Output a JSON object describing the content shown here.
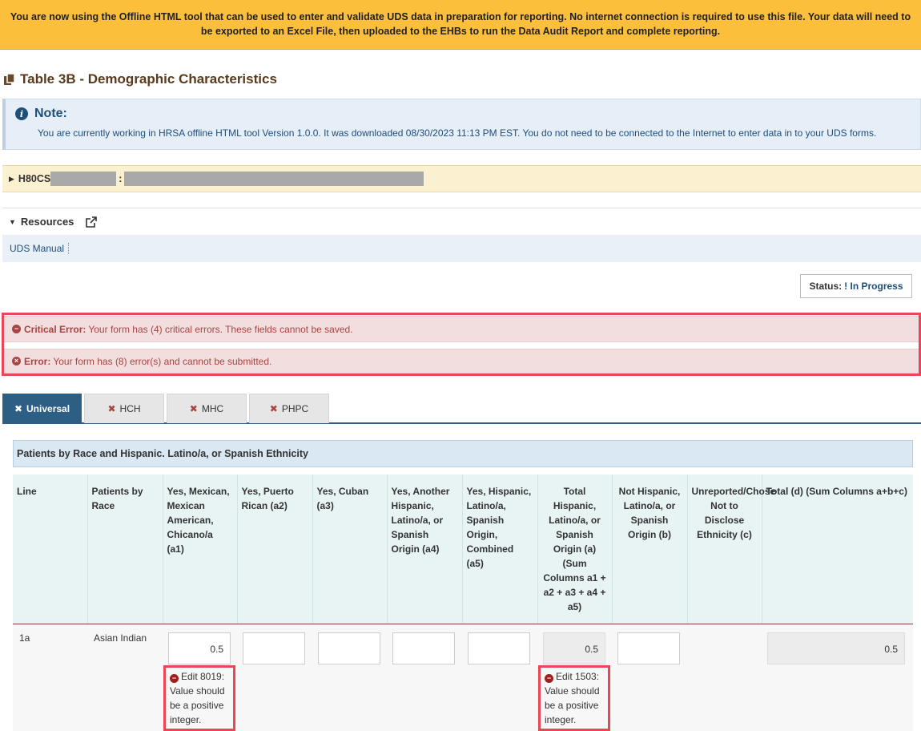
{
  "banner": {
    "text": "You are now using the Offline HTML tool that can be used to enter and validate UDS data in preparation for reporting. No internet connection is required to use this file. Your data will need to be exported to an Excel File, then uploaded to the EHBs to run the Data Audit Report and complete reporting."
  },
  "page": {
    "title": "Table 3B - Demographic Characteristics",
    "title_icon": "copy-icon"
  },
  "note": {
    "title": "Note:",
    "body": "You are currently working in HRSA offline HTML tool Version 1.0.0. It was downloaded 08/30/2023 11:13 PM EST. You do not need to be connected to the Internet to enter data in to your UDS forms."
  },
  "org": {
    "prefix": "H80CS",
    "separator": ":"
  },
  "resources": {
    "title": "Resources",
    "link": "UDS Manual"
  },
  "status": {
    "label": "Status:",
    "icon": "!",
    "value": "In Progress"
  },
  "errors": {
    "critical_label": "Critical Error:",
    "critical_text": "Your form has (4) critical errors. These fields cannot be saved.",
    "error_label": "Error:",
    "error_text": "Your form has (8) error(s) and cannot be submitted."
  },
  "tabs": [
    {
      "label": "Universal",
      "active": true
    },
    {
      "label": "HCH",
      "active": false
    },
    {
      "label": "MHC",
      "active": false
    },
    {
      "label": "PHPC",
      "active": false
    }
  ],
  "section": {
    "title": "Patients by Race and Hispanic. Latino/a, or Spanish Ethnicity"
  },
  "table": {
    "headers": [
      "Line",
      "Patients by Race",
      "Yes, Mexican, Mexican American, Chicano/a (a1)",
      "Yes, Puerto Rican (a2)",
      "Yes, Cuban (a3)",
      "Yes, Another Hispanic, Latino/a, or Spanish Origin (a4)",
      "Yes, Hispanic, Latino/a, Spanish Origin, Combined (a5)",
      "Total Hispanic, Latino/a, or Spanish Origin (a) (Sum Columns a1 + a2 + a3 + a4 + a5)",
      "Not Hispanic, Latino/a, or Spanish Origin (b)",
      "Unreported/Chose Not to Disclose Ethnicity (c)",
      "Total (d) (Sum Columns a+b+c)"
    ],
    "row": {
      "line": "1a",
      "race": "Asian Indian",
      "a1": "0.5",
      "a2": "",
      "a3": "",
      "a4": "",
      "a5": "",
      "a": "0.5",
      "b": "",
      "d": "0.5"
    },
    "edit_errors": {
      "a1": "Edit 8019: Value should be a positive integer.",
      "a": "Edit 1503: Value should be a positive integer."
    }
  }
}
